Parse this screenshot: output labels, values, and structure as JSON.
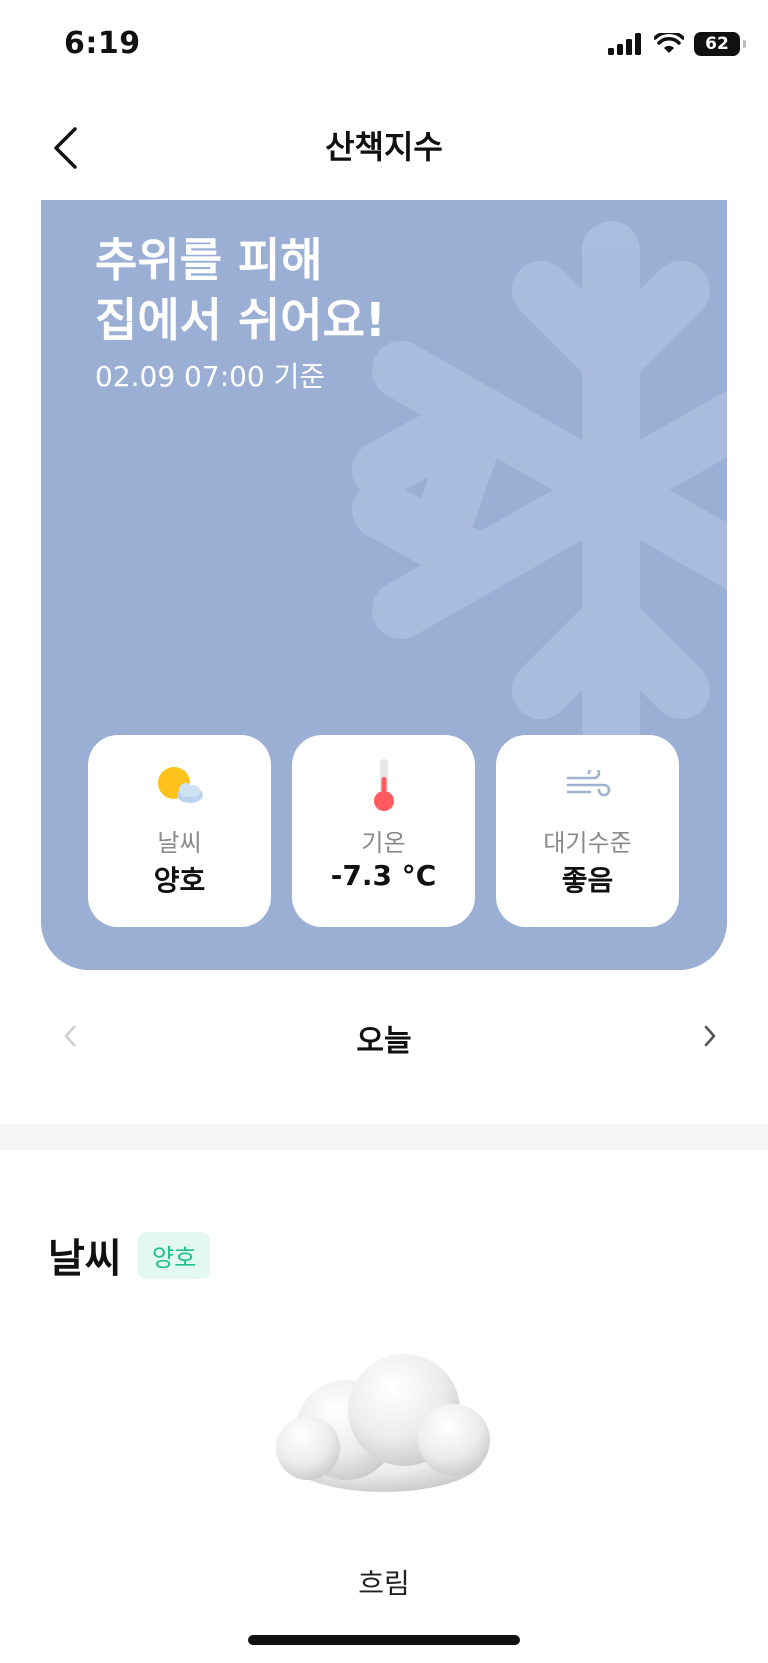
{
  "status_bar": {
    "time": "6:19",
    "battery": "62"
  },
  "nav": {
    "title": "산책지수"
  },
  "hero": {
    "headline_line1": "추위를 피해",
    "headline_line2": "집에서 쉬어요!",
    "timestamp": "02.09 07:00 기준",
    "background_color": "#9bafd5"
  },
  "metrics": [
    {
      "icon": "sun-cloud-icon",
      "label": "날씨",
      "value": "양호"
    },
    {
      "icon": "thermometer-icon",
      "label": "기온",
      "value": "-7.3 °C"
    },
    {
      "icon": "wind-icon",
      "label": "대기수준",
      "value": "좋음"
    }
  ],
  "day_selector": {
    "label": "오늘"
  },
  "weather_section": {
    "title": "날씨",
    "badge": "양호",
    "badge_color": "#1ec08c",
    "condition_caption": "흐림",
    "illustration": "cloud-illustration"
  }
}
